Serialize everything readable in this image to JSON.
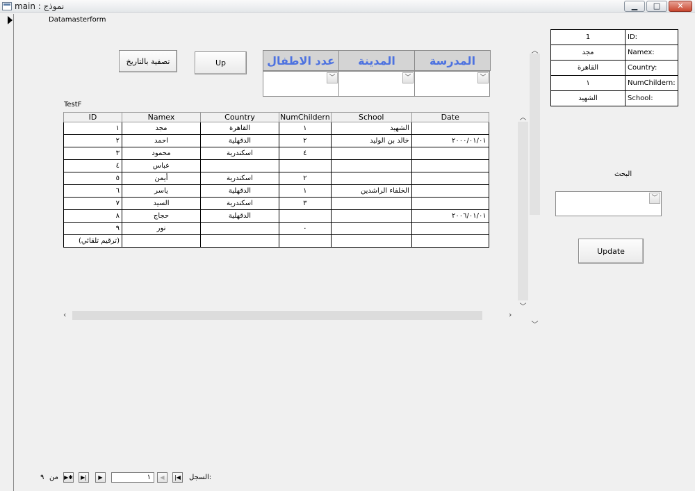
{
  "window": {
    "title": "نموذج : main",
    "min_glyph": "▁",
    "max_glyph": "□",
    "close_glyph": "✕"
  },
  "form": {
    "caption": "Datamasterform",
    "subform_caption": "TestF"
  },
  "buttons": {
    "filter_by_date": "تصفية بالتاريخ",
    "up": "Up",
    "update": "Update"
  },
  "filter_headers": {
    "school": "المدرسة",
    "city": "المدينة",
    "children_count": "عدد الاطفال"
  },
  "grid": {
    "columns": [
      "ID",
      "Namex",
      "Country",
      "NumChildern",
      "School",
      "Date"
    ],
    "rows": [
      {
        "id": "١",
        "name": "مجد",
        "country": "القاهرة",
        "num": "١",
        "school": "الشهيد",
        "date": ""
      },
      {
        "id": "٢",
        "name": "احمد",
        "country": "الدقهلية",
        "num": "٢",
        "school": "خالد بن الوليد",
        "date": "٢٠٠٠/٠١/٠١"
      },
      {
        "id": "٣",
        "name": "محمود",
        "country": "اسكندرية",
        "num": "٤",
        "school": "",
        "date": ""
      },
      {
        "id": "٤",
        "name": "عباس",
        "country": "",
        "num": "",
        "school": "",
        "date": ""
      },
      {
        "id": "٥",
        "name": "أيمن",
        "country": "اسكندرية",
        "num": "٢",
        "school": "",
        "date": ""
      },
      {
        "id": "٦",
        "name": "ياسر",
        "country": "الدقهلية",
        "num": "١",
        "school": "الخلفاء الراشدين",
        "date": ""
      },
      {
        "id": "٧",
        "name": "السيد",
        "country": "اسكندرية",
        "num": "٣",
        "school": "",
        "date": ""
      },
      {
        "id": "٨",
        "name": "حجاج",
        "country": "الدقهلية",
        "num": "",
        "school": "",
        "date": "٢٠٠٦/٠١/٠١"
      },
      {
        "id": "٩",
        "name": "نور",
        "country": "",
        "num": "٠",
        "school": "",
        "date": ""
      }
    ],
    "new_row_id": "(ترقيم تلقائي)"
  },
  "record": {
    "id_label": "ID:",
    "id_value": "1",
    "name_label": "Namex:",
    "name_value": "مجد",
    "country_label": "Country:",
    "country_value": "القاهرة",
    "num_label": "NumChildern:",
    "num_value": "١",
    "school_label": "School:",
    "school_value": "الشهيد"
  },
  "search": {
    "label": "البحث",
    "value": ""
  },
  "navigator": {
    "record_label": "السجل:",
    "current": "١",
    "of_label": "من",
    "total": "٩"
  }
}
